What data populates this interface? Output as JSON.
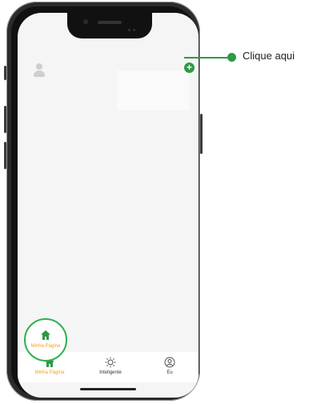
{
  "callout": {
    "text": "Clique aqui"
  },
  "tabs": [
    {
      "label": "Minha Página",
      "icon": "home-icon",
      "active": true
    },
    {
      "label": "Inteligente",
      "icon": "sun-icon"
    },
    {
      "label": "Eu",
      "icon": "user-circle-icon"
    }
  ],
  "colors": {
    "accent": "#2e9a45",
    "active_tab": "#f0a020",
    "highlight": "#2eb050"
  }
}
